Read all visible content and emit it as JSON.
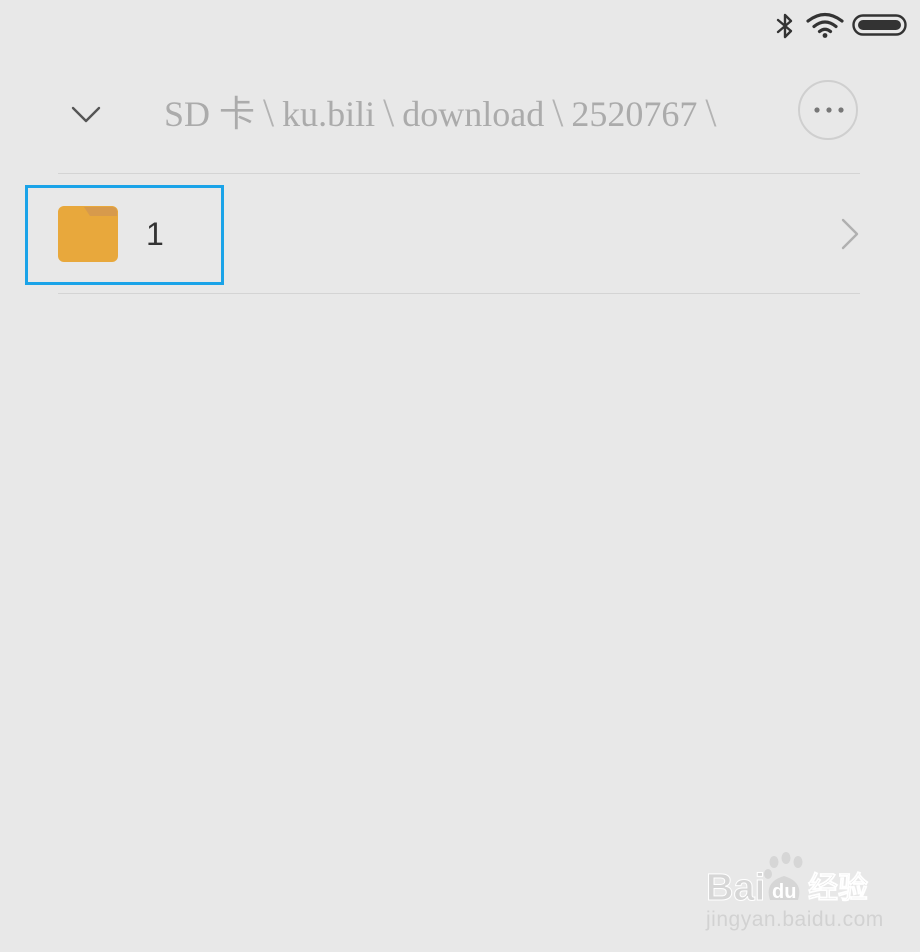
{
  "status_bar": {
    "icons": [
      "bluetooth-icon",
      "wifi-icon",
      "battery-icon"
    ]
  },
  "header": {
    "collapse_icon": "chevron-down-icon",
    "breadcrumb": [
      "SD 卡",
      "ku.bili",
      "download",
      "2520767"
    ],
    "separator": "\\",
    "more_icon": "more-horizontal-icon"
  },
  "folders": [
    {
      "name": "1",
      "icon": "folder-icon",
      "icon_color": "#e8a83c",
      "chevron_icon": "chevron-right-icon"
    }
  ],
  "highlight": {
    "color": "#1aa3e8"
  },
  "watermark": {
    "logo_text": "Baidu经验",
    "url": "jingyan.baidu.com"
  },
  "colors": {
    "background": "#e8e8e8",
    "breadcrumb_text": "#ababab",
    "folder": "#e8a83c",
    "folder_tab": "#d9954a",
    "highlight": "#1aa3e8"
  }
}
